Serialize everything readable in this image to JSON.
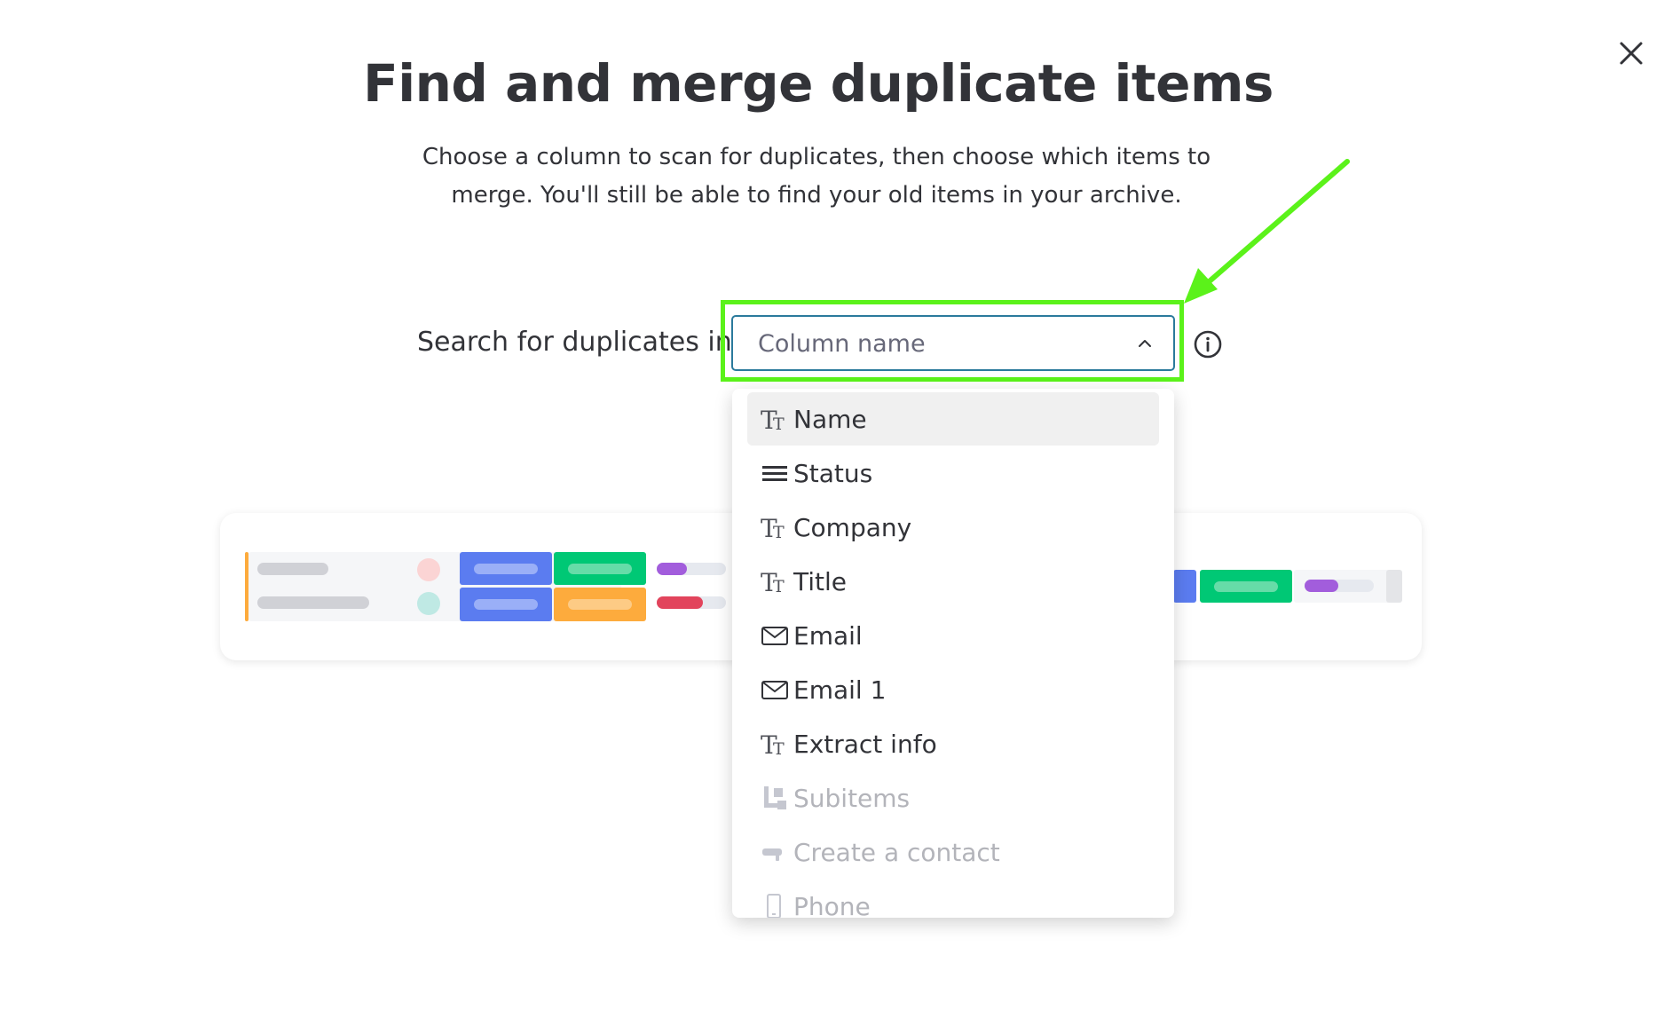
{
  "dialog": {
    "title": "Find and merge duplicate items",
    "subtitle_line1": "Choose a column to scan for duplicates, then choose which items to",
    "subtitle_line2": "merge. You'll still be able to find your old items in your archive.",
    "close_icon": "close-icon"
  },
  "search": {
    "label": "Search for duplicates in",
    "select_placeholder": "Column name",
    "chevron_icon": "chevron-up-icon",
    "info_icon": "info-icon"
  },
  "annotation": {
    "highlight_color": "#5bf21a",
    "arrow_icon": "arrow-icon"
  },
  "dropdown": {
    "options": [
      {
        "label": "Name",
        "icon": "text-icon",
        "disabled": false,
        "selected": true
      },
      {
        "label": "Status",
        "icon": "status-icon",
        "disabled": false,
        "selected": false
      },
      {
        "label": "Company",
        "icon": "text-icon",
        "disabled": false,
        "selected": false
      },
      {
        "label": "Title",
        "icon": "text-icon",
        "disabled": false,
        "selected": false
      },
      {
        "label": "Email",
        "icon": "email-icon",
        "disabled": false,
        "selected": false
      },
      {
        "label": "Email 1",
        "icon": "email-icon",
        "disabled": false,
        "selected": false
      },
      {
        "label": "Extract info",
        "icon": "text-icon",
        "disabled": false,
        "selected": false
      },
      {
        "label": "Subitems",
        "icon": "subitems-icon",
        "disabled": true,
        "selected": false
      },
      {
        "label": "Create a contact",
        "icon": "button-icon",
        "disabled": true,
        "selected": false
      },
      {
        "label": "Phone",
        "icon": "phone-icon",
        "disabled": true,
        "selected": false
      }
    ]
  },
  "colors": {
    "blue": "#5b7cf0",
    "green": "#00c875",
    "orange": "#fdab3d",
    "purple": "#a25ddc",
    "red": "#e2445c"
  }
}
